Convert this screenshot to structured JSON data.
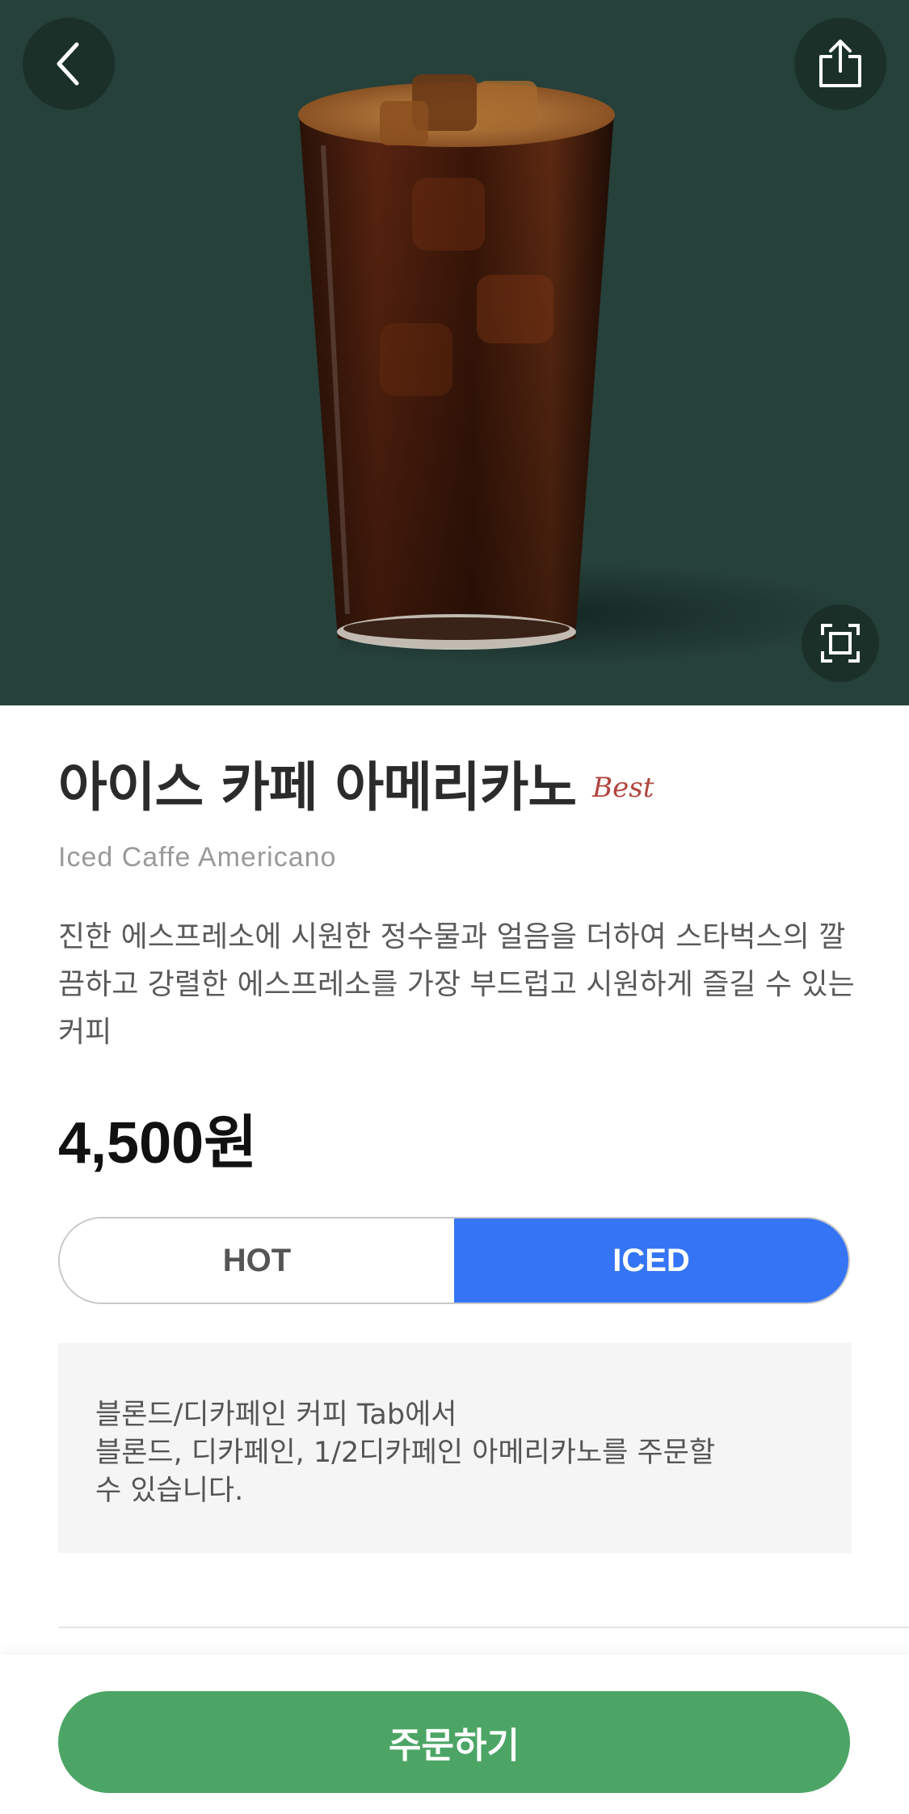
{
  "header": {
    "back_icon": "chevron-left-icon",
    "share_icon": "share-icon",
    "fullscreen_icon": "fullscreen-icon",
    "hero_background": "#26403a"
  },
  "product": {
    "name_ko": "아이스 카페 아메리카노",
    "badge": "Best",
    "name_en": "Iced Caffe Americano",
    "description": "진한 에스프레소에 시원한 정수물과 얼음을 더하여 스타벅스의 깔끔하고 강렬한 에스프레소를 가장 부드럽고 시원하게 즐길 수 있는 커피",
    "price": "4,500원"
  },
  "temperature_toggle": {
    "options": [
      {
        "label": "HOT",
        "selected": false
      },
      {
        "label": "ICED",
        "selected": true
      }
    ],
    "selected_color": "#3575f5"
  },
  "notice": {
    "line1": "블론드/디카페인 커피 Tab에서",
    "line2": "블론드, 디카페인, 1/2디카페인 아메리카노를 주문할",
    "line3": "수 있습니다."
  },
  "order_button": {
    "label": "주문하기",
    "color": "#4ca565"
  }
}
